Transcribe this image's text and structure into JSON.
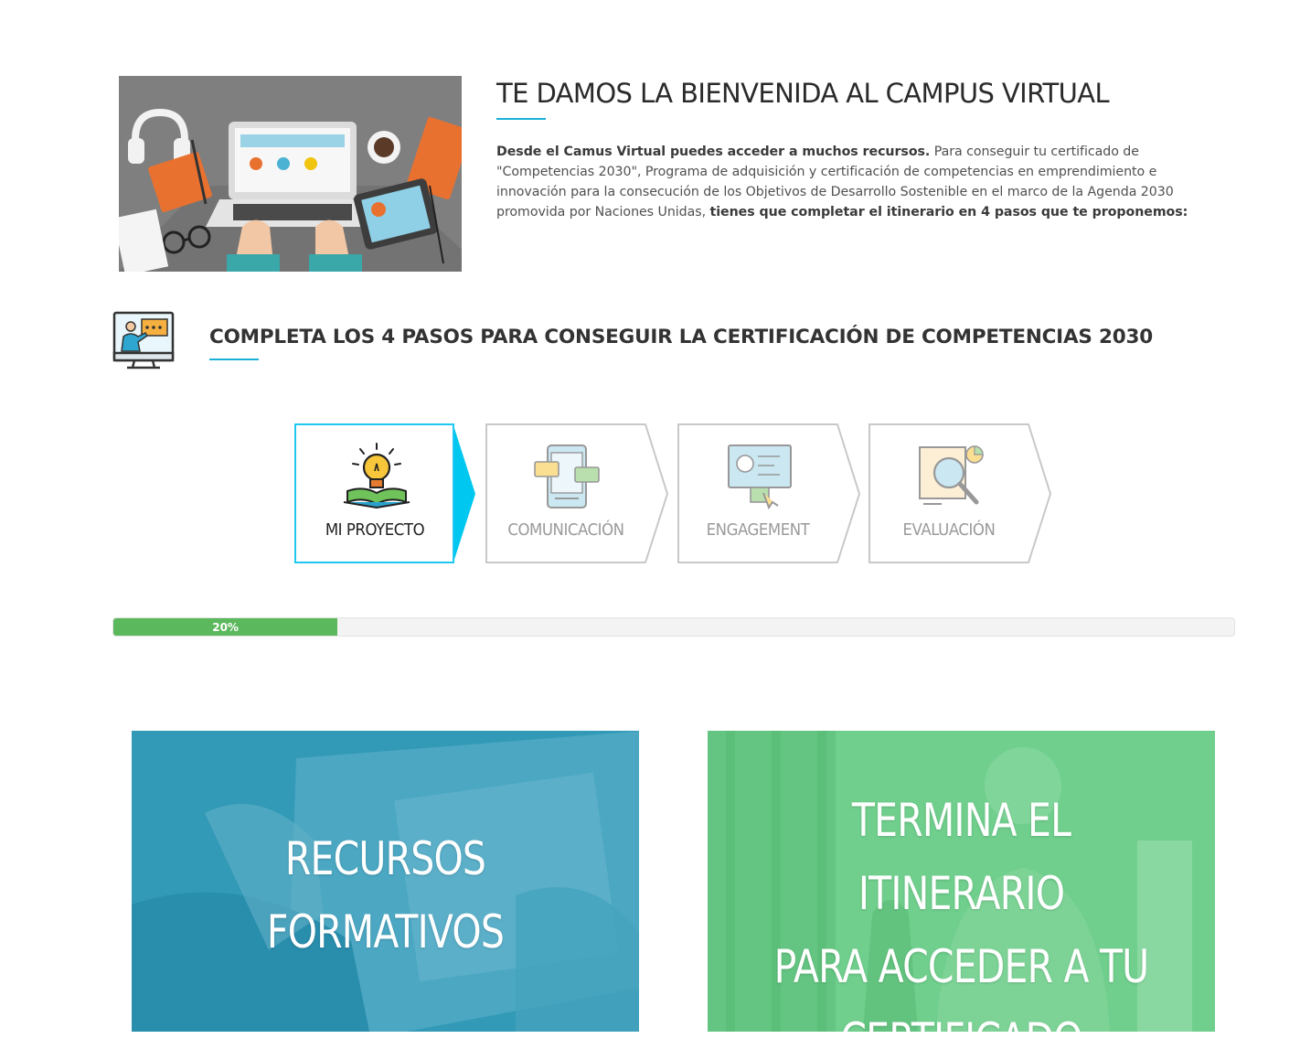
{
  "welcome": {
    "title": "TE DAMOS LA BIENVENIDA AL CAMPUS VIRTUAL",
    "intro_bold": "Desde el Camus Virtual puedes acceder a muchos recursos.",
    "intro_text": " Para conseguir tu certificado de \"Competencias 2030\", Programa de adquisición y certificación de competencias en emprendimiento e innovación para la consecución de los Objetivos de Desarrollo Sostenible en el marco de la Agenda 2030 promovida por Naciones Unidas, ",
    "intro_bold_end": "tiene s que completar el itinerario en 4 pasos que te proponemos:"
  },
  "steps": {
    "title": "COMPLETA LOS 4 PASOS PARA CONSEGUIR LA CERTIFICACIÓN DE COMPETENCIAS 2030",
    "items": [
      {
        "label": "MI PROYECTO",
        "icon": "lightbulb-book-icon",
        "active": true
      },
      {
        "label": "COMUNICACIÓN",
        "icon": "mobile-chat-icon",
        "active": false
      },
      {
        "label": "ENGAGEMENT",
        "icon": "interactive-screen-icon",
        "active": false
      },
      {
        "label": "EVALUACIÓN",
        "icon": "magnifier-chart-icon",
        "active": false
      }
    ]
  },
  "progress": {
    "value": 20,
    "label": "20%"
  },
  "cards": {
    "resources": {
      "line1": "RECURSOS",
      "line2": "FORMATIVOS"
    },
    "certificate": {
      "line1": "TERMINA EL ITINERARIO",
      "line2": "PARA ACCEDER A TU",
      "line3": "CERTIFICADO"
    }
  },
  "colors": {
    "accent": "#1bb0d8",
    "progress": "#5cb85c",
    "active_border": "#1ec8f0",
    "card_blue": "#2f9bb8",
    "card_green": "#6cc98a"
  }
}
